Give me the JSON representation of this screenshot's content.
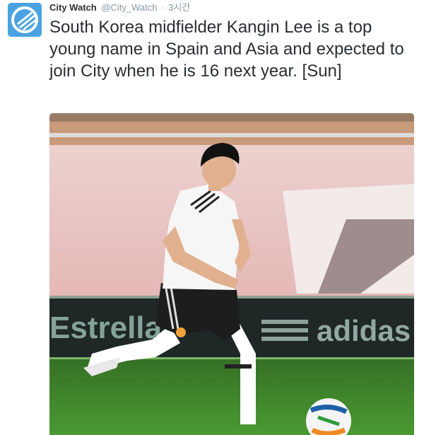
{
  "tweet": {
    "account_name": "City Watch",
    "handle": "@City_Watch",
    "separator": "·",
    "timestamp": "3시간",
    "text": "South Korea midfielder Kangin Lee is a top young name in Spain and Asia and expected to join City when he is 16 next year. [Sun]",
    "avatar_icon": "city-watch-logo-icon"
  },
  "photo": {
    "ad_board_left": "Estrella",
    "ad_board_right": "adidas",
    "colors": {
      "sky_wall": "#e9c6c4",
      "ad_board": "#1f2727",
      "pitch": "#3f8a2c",
      "accent": "#4aa3e0"
    }
  }
}
